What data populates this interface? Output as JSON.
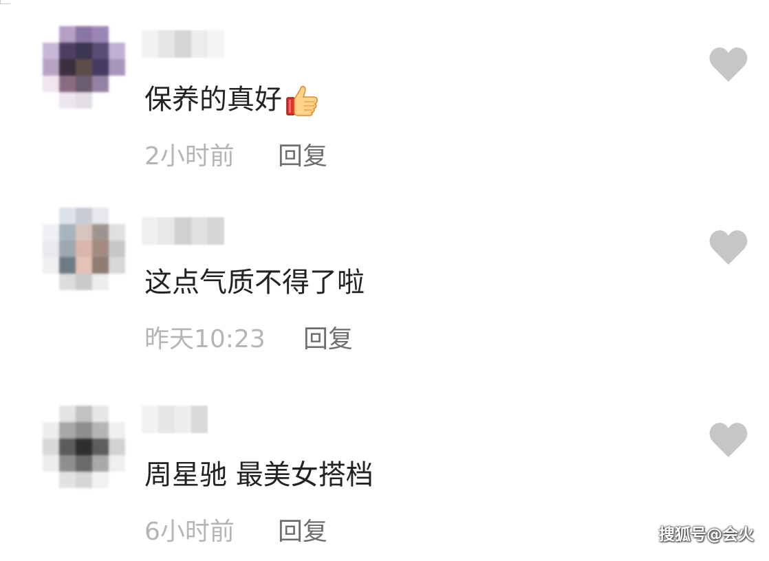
{
  "comments": [
    {
      "text": "保养的真好",
      "emoji": "thumbs-up-icon",
      "time": "2小时前",
      "reply_label": "回复"
    },
    {
      "text": "这点气质不得了啦",
      "time": "昨天10:23",
      "reply_label": "回复"
    },
    {
      "text": "周星驰 最美女搭档",
      "time": "6小时前",
      "reply_label": "回复"
    }
  ],
  "watermark": "搜狐号@会火",
  "colors": {
    "comment_text": "#222222",
    "timestamp": "#b5b5b5",
    "reply": "#6e6e6e",
    "heart": "#c6c6c6"
  }
}
